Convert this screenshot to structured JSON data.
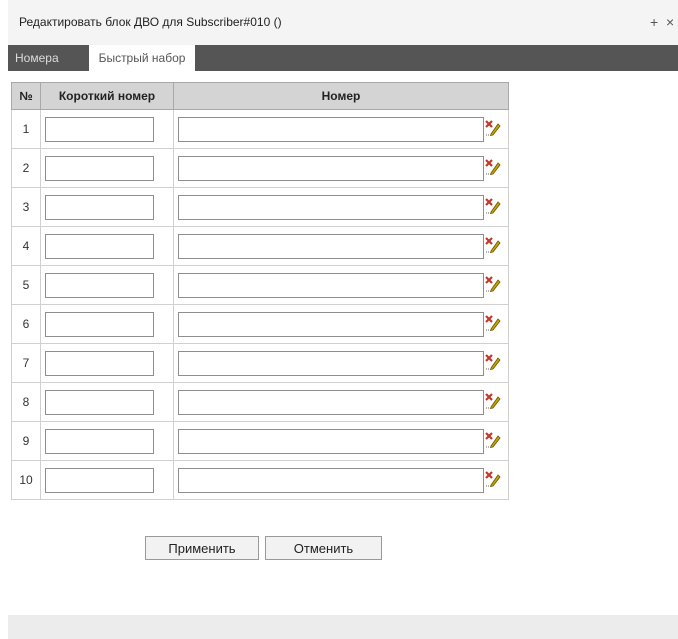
{
  "window": {
    "title": "Редактировать блок ДВО для Subscriber#010 ()",
    "plus_label": "+",
    "close_label": "×"
  },
  "tabs": [
    {
      "label": "Номера",
      "active": false
    },
    {
      "label": "Быстрый набор",
      "active": true
    }
  ],
  "table": {
    "headers": {
      "num": "№",
      "short": "Короткий номер",
      "phone": "Номер"
    },
    "rows": [
      {
        "num": "1",
        "short": "",
        "phone": ""
      },
      {
        "num": "2",
        "short": "",
        "phone": ""
      },
      {
        "num": "3",
        "short": "",
        "phone": ""
      },
      {
        "num": "4",
        "short": "",
        "phone": ""
      },
      {
        "num": "5",
        "short": "",
        "phone": ""
      },
      {
        "num": "6",
        "short": "",
        "phone": ""
      },
      {
        "num": "7",
        "short": "",
        "phone": ""
      },
      {
        "num": "8",
        "short": "",
        "phone": ""
      },
      {
        "num": "9",
        "short": "",
        "phone": ""
      },
      {
        "num": "10",
        "short": "",
        "phone": ""
      }
    ],
    "row_action_icon": "clear-field-icon"
  },
  "buttons": {
    "apply": "Применить",
    "cancel": "Отменить"
  },
  "colors": {
    "tab_bar": "#555555",
    "header_bg": "#d4d4d4",
    "icon_red": "#c0392b",
    "icon_pencil": "#c8a400"
  }
}
